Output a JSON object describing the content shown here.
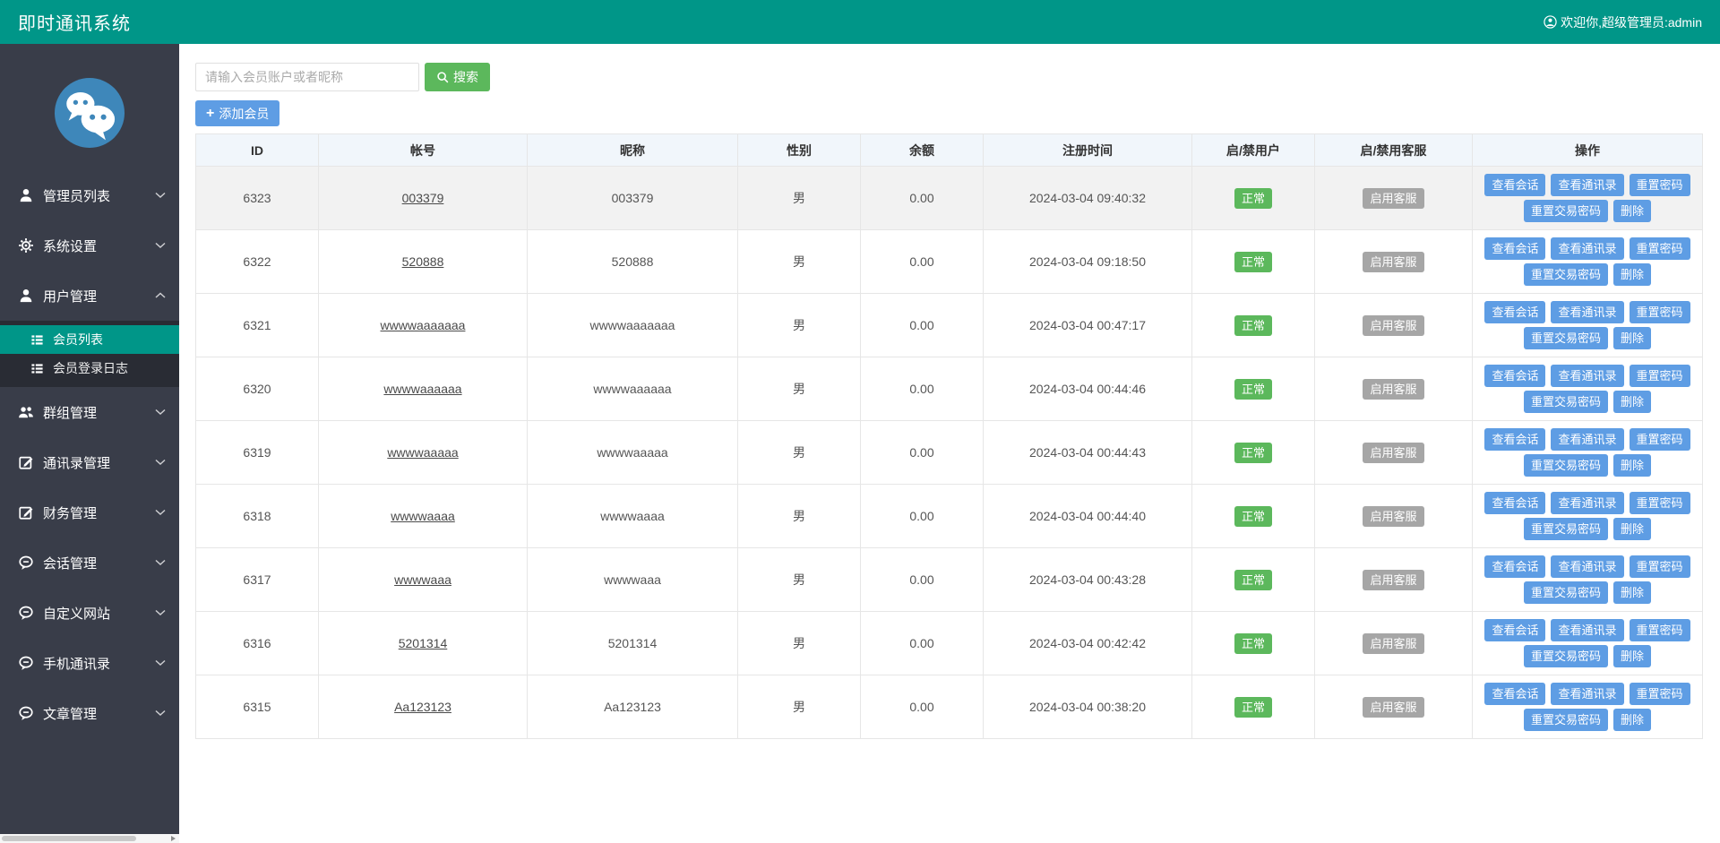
{
  "header": {
    "title": "即时通讯系统",
    "welcome": "欢迎你,超级管理员:admin",
    "user_icon": "user-circle-icon"
  },
  "sidebar": {
    "logo_icon": "wechat-logo-icon",
    "items": [
      {
        "name": "admin-list",
        "label": "管理员列表",
        "icon": "user-icon",
        "chevron": "down"
      },
      {
        "name": "system-settings",
        "label": "系统设置",
        "icon": "gear-icon",
        "chevron": "down"
      },
      {
        "name": "user-management",
        "label": "用户管理",
        "icon": "user-icon",
        "chevron": "up",
        "children": [
          {
            "name": "member-list",
            "label": "会员列表",
            "icon": "list-icon",
            "active": true
          },
          {
            "name": "member-login-log",
            "label": "会员登录日志",
            "icon": "list-icon",
            "active": false
          }
        ]
      },
      {
        "name": "group-management",
        "label": "群组管理",
        "icon": "group-icon",
        "chevron": "down"
      },
      {
        "name": "contacts-management",
        "label": "通讯录管理",
        "icon": "edit-icon",
        "chevron": "down"
      },
      {
        "name": "finance-management",
        "label": "财务管理",
        "icon": "edit-icon",
        "chevron": "down"
      },
      {
        "name": "session-management",
        "label": "会话管理",
        "icon": "comment-icon",
        "chevron": "down"
      },
      {
        "name": "custom-website",
        "label": "自定义网站",
        "icon": "comment-icon",
        "chevron": "down"
      },
      {
        "name": "phone-contacts",
        "label": "手机通讯录",
        "icon": "comment-icon",
        "chevron": "down"
      },
      {
        "name": "article-management",
        "label": "文章管理",
        "icon": "comment-icon",
        "chevron": "down"
      }
    ]
  },
  "toolbar": {
    "search_placeholder": "请输入会员账户或者昵称",
    "search_label": "搜索",
    "add_label": "添加会员"
  },
  "table": {
    "columns": [
      "ID",
      "帐号",
      "昵称",
      "性别",
      "余额",
      "注册时间",
      "启/禁用户",
      "启/禁用客服",
      "操作"
    ],
    "actions_row1": [
      {
        "name": "view-session",
        "label": "查看会话"
      },
      {
        "name": "view-contacts",
        "label": "查看通讯录"
      },
      {
        "name": "reset-password",
        "label": "重置密码"
      }
    ],
    "actions_row2": [
      {
        "name": "reset-trade-password",
        "label": "重置交易密码"
      },
      {
        "name": "delete",
        "label": "删除"
      }
    ],
    "rows": [
      {
        "id": "6323",
        "account": "003379",
        "nickname": "003379",
        "gender": "男",
        "balance": "0.00",
        "reg_time": "2024-03-04 09:40:32",
        "user_status": "正常",
        "service_status": "启用客服",
        "highlighted": true
      },
      {
        "id": "6322",
        "account": "520888",
        "nickname": "520888",
        "gender": "男",
        "balance": "0.00",
        "reg_time": "2024-03-04 09:18:50",
        "user_status": "正常",
        "service_status": "启用客服",
        "highlighted": false
      },
      {
        "id": "6321",
        "account": "wwwwaaaaaaa",
        "nickname": "wwwwaaaaaaa",
        "gender": "男",
        "balance": "0.00",
        "reg_time": "2024-03-04 00:47:17",
        "user_status": "正常",
        "service_status": "启用客服",
        "highlighted": false
      },
      {
        "id": "6320",
        "account": "wwwwaaaaaa",
        "nickname": "wwwwaaaaaa",
        "gender": "男",
        "balance": "0.00",
        "reg_time": "2024-03-04 00:44:46",
        "user_status": "正常",
        "service_status": "启用客服",
        "highlighted": false
      },
      {
        "id": "6319",
        "account": "wwwwaaaaa",
        "nickname": "wwwwaaaaa",
        "gender": "男",
        "balance": "0.00",
        "reg_time": "2024-03-04 00:44:43",
        "user_status": "正常",
        "service_status": "启用客服",
        "highlighted": false
      },
      {
        "id": "6318",
        "account": "wwwwaaaa",
        "nickname": "wwwwaaaa",
        "gender": "男",
        "balance": "0.00",
        "reg_time": "2024-03-04 00:44:40",
        "user_status": "正常",
        "service_status": "启用客服",
        "highlighted": false
      },
      {
        "id": "6317",
        "account": "wwwwaaa",
        "nickname": "wwwwaaa",
        "gender": "男",
        "balance": "0.00",
        "reg_time": "2024-03-04 00:43:28",
        "user_status": "正常",
        "service_status": "启用客服",
        "highlighted": false
      },
      {
        "id": "6316",
        "account": "5201314",
        "nickname": "5201314",
        "gender": "男",
        "balance": "0.00",
        "reg_time": "2024-03-04 00:42:42",
        "user_status": "正常",
        "service_status": "启用客服",
        "highlighted": false
      },
      {
        "id": "6315",
        "account": "Aa123123",
        "nickname": "Aa123123",
        "gender": "男",
        "balance": "0.00",
        "reg_time": "2024-03-04 00:38:20",
        "user_status": "正常",
        "service_status": "启用客服",
        "highlighted": false
      }
    ]
  },
  "colors": {
    "accent": "#009688",
    "green": "#5CB85C",
    "blue": "#5e9de4",
    "sidebar_bg": "#393D49",
    "badge_gray": "#a6a6a6",
    "header_row_bg": "#f1f6fb"
  }
}
